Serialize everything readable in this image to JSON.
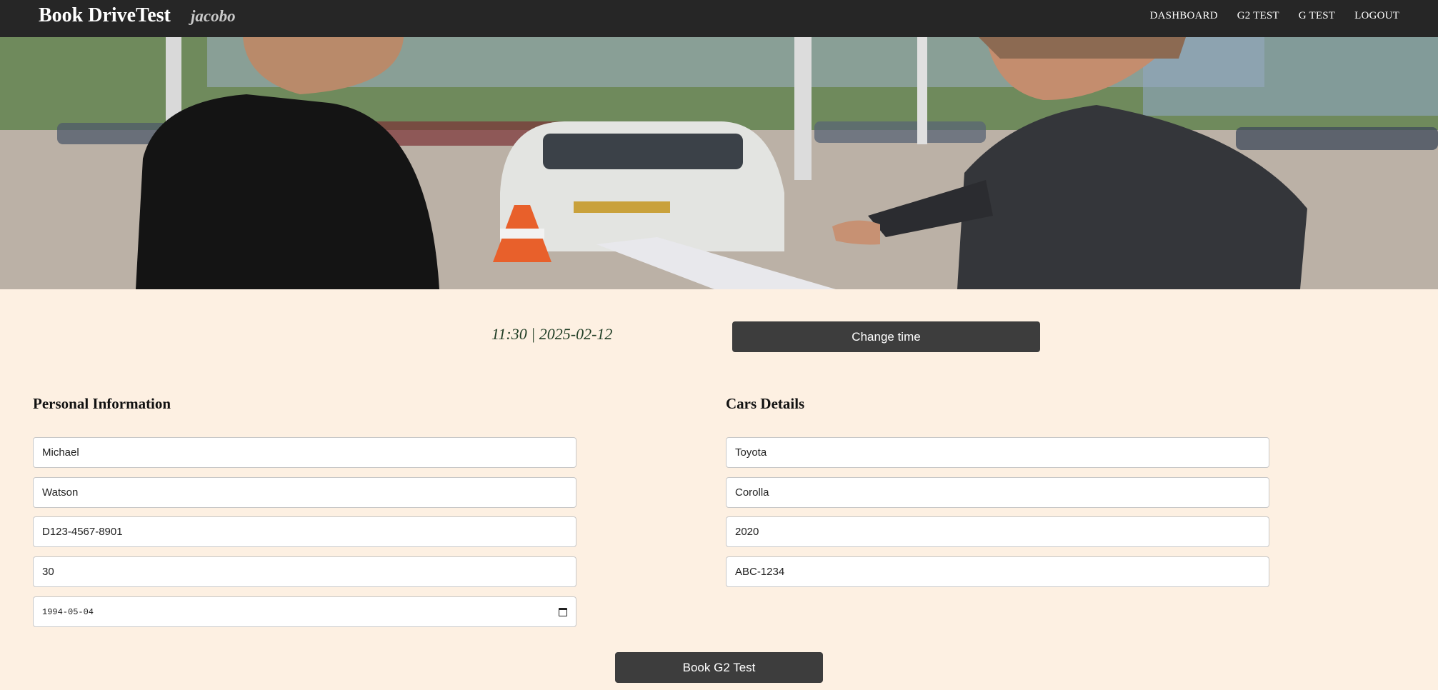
{
  "header": {
    "brand": "Book DriveTest",
    "username": "jacobo",
    "nav": [
      "DASHBOARD",
      "G2 TEST",
      "G TEST",
      "LOGOUT"
    ]
  },
  "appointment": {
    "display": "11:30 | 2025-02-12",
    "change_label": "Change time"
  },
  "personal": {
    "title": "Personal Information",
    "first_name": "Michael",
    "last_name": "Watson",
    "license": "D123-4567-8901",
    "age": "30",
    "dob": "1994-05-04"
  },
  "car": {
    "title": "Cars Details",
    "make": "Toyota",
    "model": "Corolla",
    "year": "2020",
    "plate": "ABC-1234"
  },
  "submit_label": "Book G2 Test",
  "icons": {
    "calendar": "calendar-icon"
  }
}
